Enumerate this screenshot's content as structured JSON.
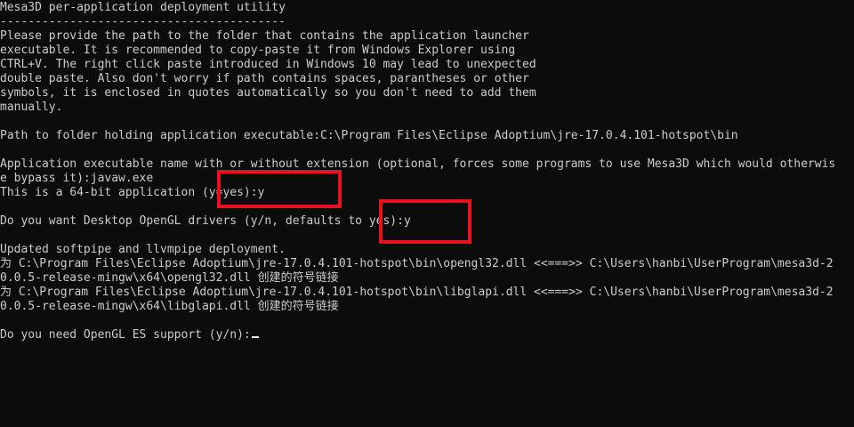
{
  "terminal": {
    "lines": [
      "Mesa3D per-application deployment utility",
      "-----------------------------------------",
      "Please provide the path to the folder that contains the application launcher",
      "executable. It is recommended to copy-paste it from Windows Explorer using",
      "CTRL+V. The right click paste introduced in Windows 10 may lead to unexpected",
      "double paste. Also don't worry if path contains spaces, parantheses or other",
      "symbols, it is enclosed in quotes automatically so you don't need to add them",
      "manually.",
      "",
      "Path to folder holding application executable:C:\\Program Files\\Eclipse Adoptium\\jre-17.0.4.101-hotspot\\bin",
      "",
      "Application executable name with or without extension (optional, forces some programs to use Mesa3D which would otherwis",
      "e bypass it):javaw.exe",
      "This is a 64-bit application (y=yes):y",
      "",
      "Do you want Desktop OpenGL drivers (y/n, defaults to yes):y",
      "",
      "Updated softpipe and llvmpipe deployment.",
      "为 C:\\Program Files\\Eclipse Adoptium\\jre-17.0.4.101-hotspot\\bin\\opengl32.dll <<===>> C:\\Users\\hanbi\\UserProgram\\mesa3d-2",
      "0.0.5-release-mingw\\x64\\opengl32.dll 创建的符号链接",
      "为 C:\\Program Files\\Eclipse Adoptium\\jre-17.0.4.101-hotspot\\bin\\libglapi.dll <<===>> C:\\Users\\hanbi\\UserProgram\\mesa3d-2",
      "0.0.5-release-mingw\\x64\\libglapi.dll 创建的符号链接",
      "",
      "Do you need OpenGL ES support (y/n):"
    ]
  },
  "colors": {
    "background": "#0c0c0c",
    "text": "#cccccc",
    "highlight": "#e81123"
  }
}
